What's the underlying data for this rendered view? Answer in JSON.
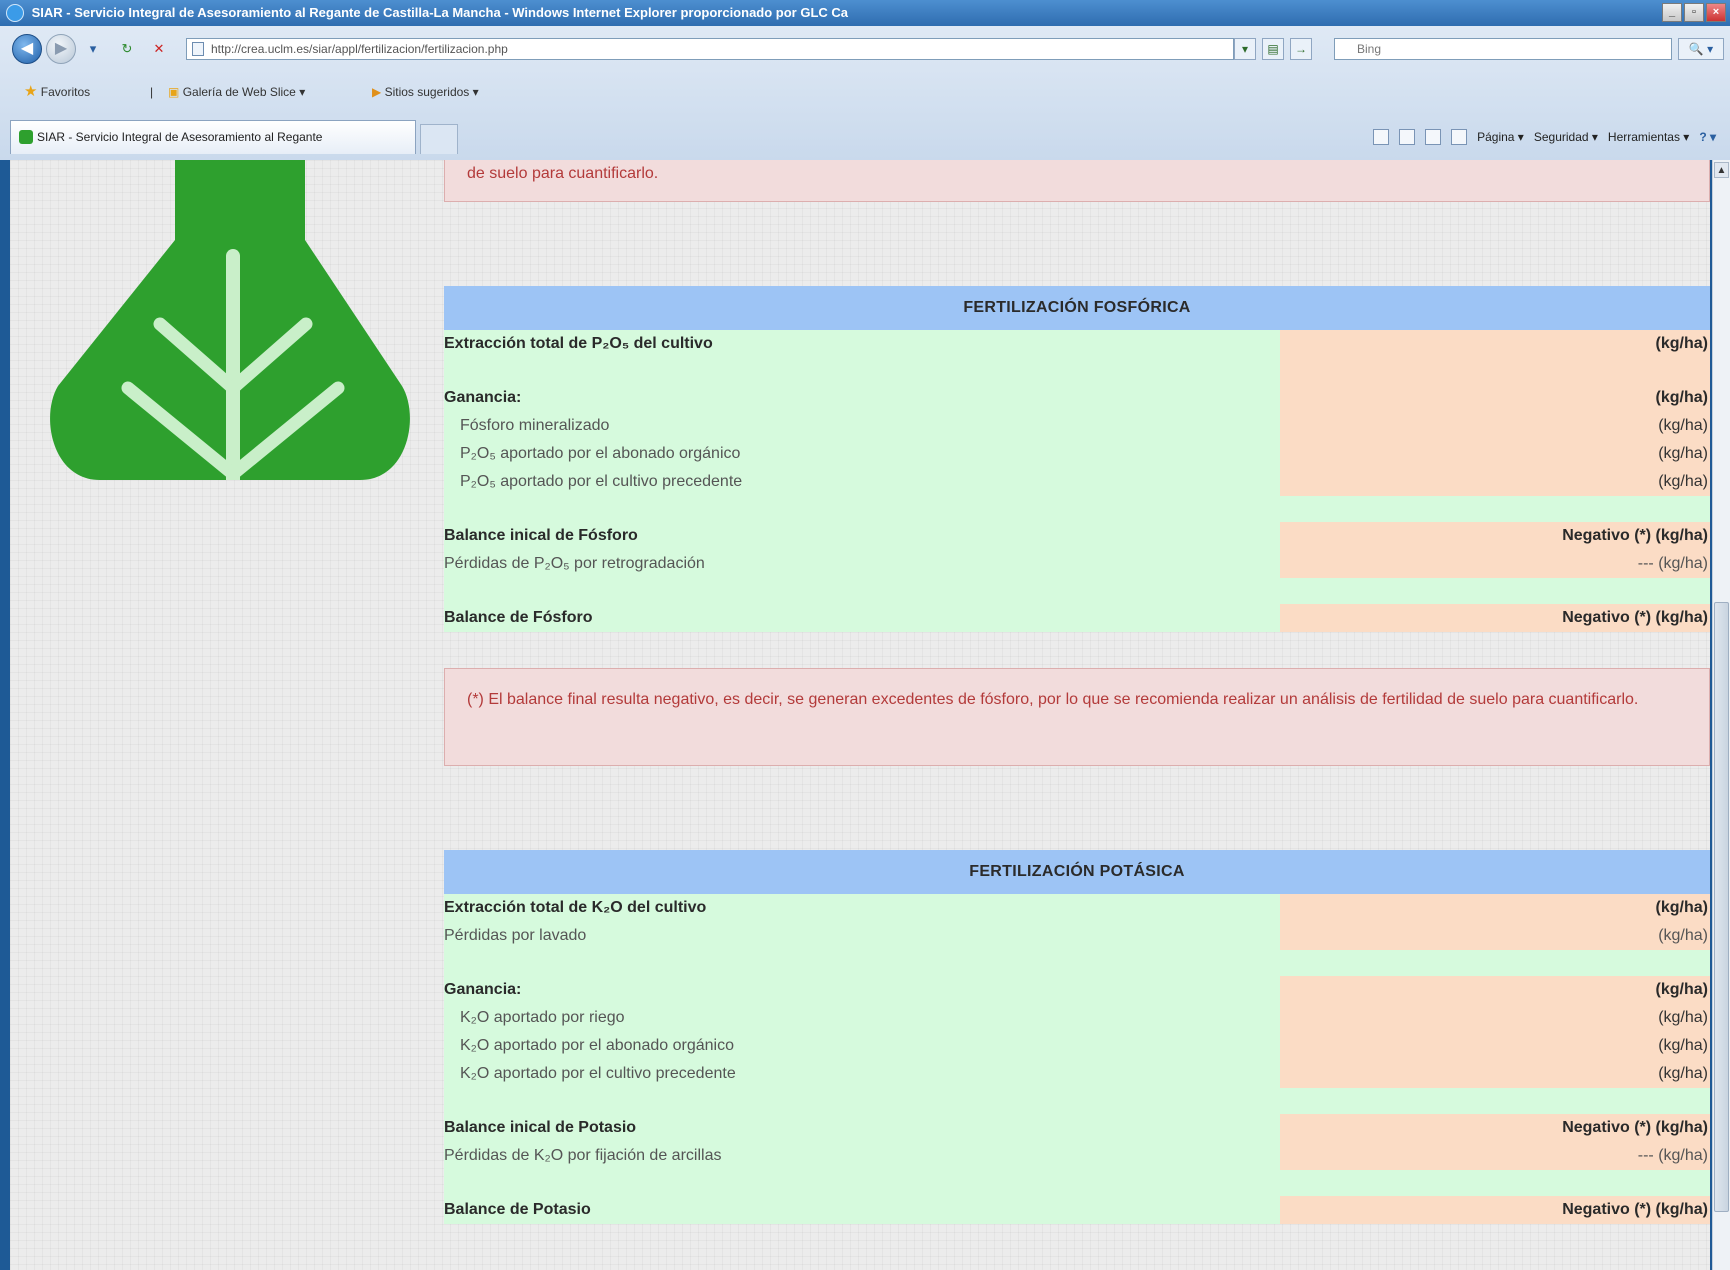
{
  "window": {
    "title": "SIAR - Servicio Integral de Asesoramiento al Regante de Castilla-La Mancha - Windows Internet Explorer proporcionado por GLC Ca",
    "min": "_",
    "max": "▫",
    "close": "×"
  },
  "browser": {
    "back": "◀",
    "forward": "▶",
    "refresh": "↻",
    "stop": "✕",
    "address": "http://crea.uclm.es/siar/appl/fertilizacion/fertilizacion.php",
    "go": "→",
    "search_placeholder": "Bing",
    "search_button": "🔍 ▾",
    "favorites_label": "Favoritos",
    "fav_item_1": "Galería de Web Slice ▾",
    "fav_item_2": "Sitios sugeridos ▾",
    "tab_label": "SIAR - Servicio Integral de Asesoramiento al Regante",
    "cmd_page": "Página ▾",
    "cmd_security": "Seguridad ▾",
    "cmd_tools": "Herramientas ▾",
    "cmd_help": "? ▾"
  },
  "top_alert_text": "de suelo para cuantificarlo.",
  "phosphorus": {
    "header": "FERTILIZACIÓN FOSFÓRICA",
    "extraction_label": "Extracción total de P₂O₅ del cultivo",
    "extraction_value": "(kg/ha)",
    "gain_label": "Ganancia:",
    "gain_value": "(kg/ha)",
    "sub_1_label": "Fósforo mineralizado",
    "sub_1_value": "(kg/ha)",
    "sub_2_label": "P₂O₅ aportado por el abonado orgánico",
    "sub_2_value": "(kg/ha)",
    "sub_3_label": "P₂O₅ aportado por el cultivo precedente",
    "sub_3_value": "(kg/ha)",
    "initial_balance_label": "Balance inical de Fósforo",
    "initial_balance_value": "Negativo (*) (kg/ha)",
    "losses_label": "Pérdidas de P₂O₅ por retrogradación",
    "losses_value": "--- (kg/ha)",
    "balance_label": "Balance de Fósforo",
    "balance_value": "Negativo (*) (kg/ha)",
    "alert_text": "(*) El balance final resulta negativo, es decir, se generan excedentes de fósforo, por lo que se recomienda realizar un análisis de fertilidad de suelo para cuantificarlo."
  },
  "potassium": {
    "header": "FERTILIZACIÓN POTÁSICA",
    "extraction_label": "Extracción total de K₂O del cultivo",
    "extraction_value": "(kg/ha)",
    "losses_wash_label": "Pérdidas por lavado",
    "losses_wash_value": "(kg/ha)",
    "gain_label": "Ganancia:",
    "gain_value": "(kg/ha)",
    "sub_1_label": "K₂O aportado por riego",
    "sub_1_value": "(kg/ha)",
    "sub_2_label": "K₂O aportado por el abonado orgánico",
    "sub_2_value": "(kg/ha)",
    "sub_3_label": "K₂O aportado por el cultivo precedente",
    "sub_3_value": "(kg/ha)",
    "initial_balance_label": "Balance inical de Potasio",
    "initial_balance_value": "Negativo (*) (kg/ha)",
    "fixation_label": "Pérdidas de K₂O por fijación de arcillas",
    "fixation_value": "--- (kg/ha)",
    "balance_label": "Balance de Potasio",
    "balance_value": "Negativo (*) (kg/ha)"
  },
  "colors": {
    "header_blue": "#9dc4f5",
    "label_green": "#d6fadd",
    "value_orange": "#fbdcc5",
    "alert_pink": "#f2dcdc",
    "logo_green": "#2ea02e"
  }
}
